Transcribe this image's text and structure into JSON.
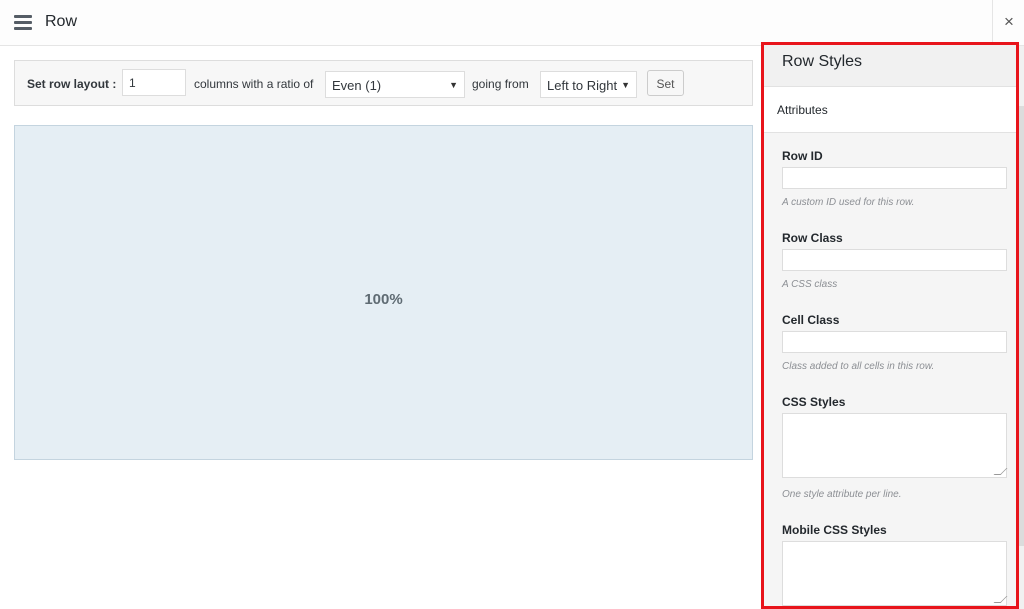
{
  "header": {
    "title": "Row",
    "menu_icon": "hamburger-icon",
    "close_label": "×"
  },
  "toolbar": {
    "layout_label": "Set row layout :",
    "columns_value": "1",
    "ratio_label": "columns with a ratio of",
    "ratio_selected": "Even (1)",
    "direction_label": "going from",
    "direction_selected": "Left to Right",
    "set_label": "Set"
  },
  "cell": {
    "width_label": "100%"
  },
  "sidebar": {
    "title": "Row Styles",
    "section": "Attributes",
    "fields": [
      {
        "label": "Row ID",
        "description": "A custom ID used for this row."
      },
      {
        "label": "Row Class",
        "description": "A CSS class"
      },
      {
        "label": "Cell Class",
        "description": "Class added to all cells in this row."
      },
      {
        "label": "CSS Styles",
        "description": "One style attribute per line."
      },
      {
        "label": "Mobile CSS Styles",
        "description": ""
      }
    ]
  },
  "colors": {
    "highlight": "#e8141b",
    "cell_background": "#e5eef4"
  }
}
